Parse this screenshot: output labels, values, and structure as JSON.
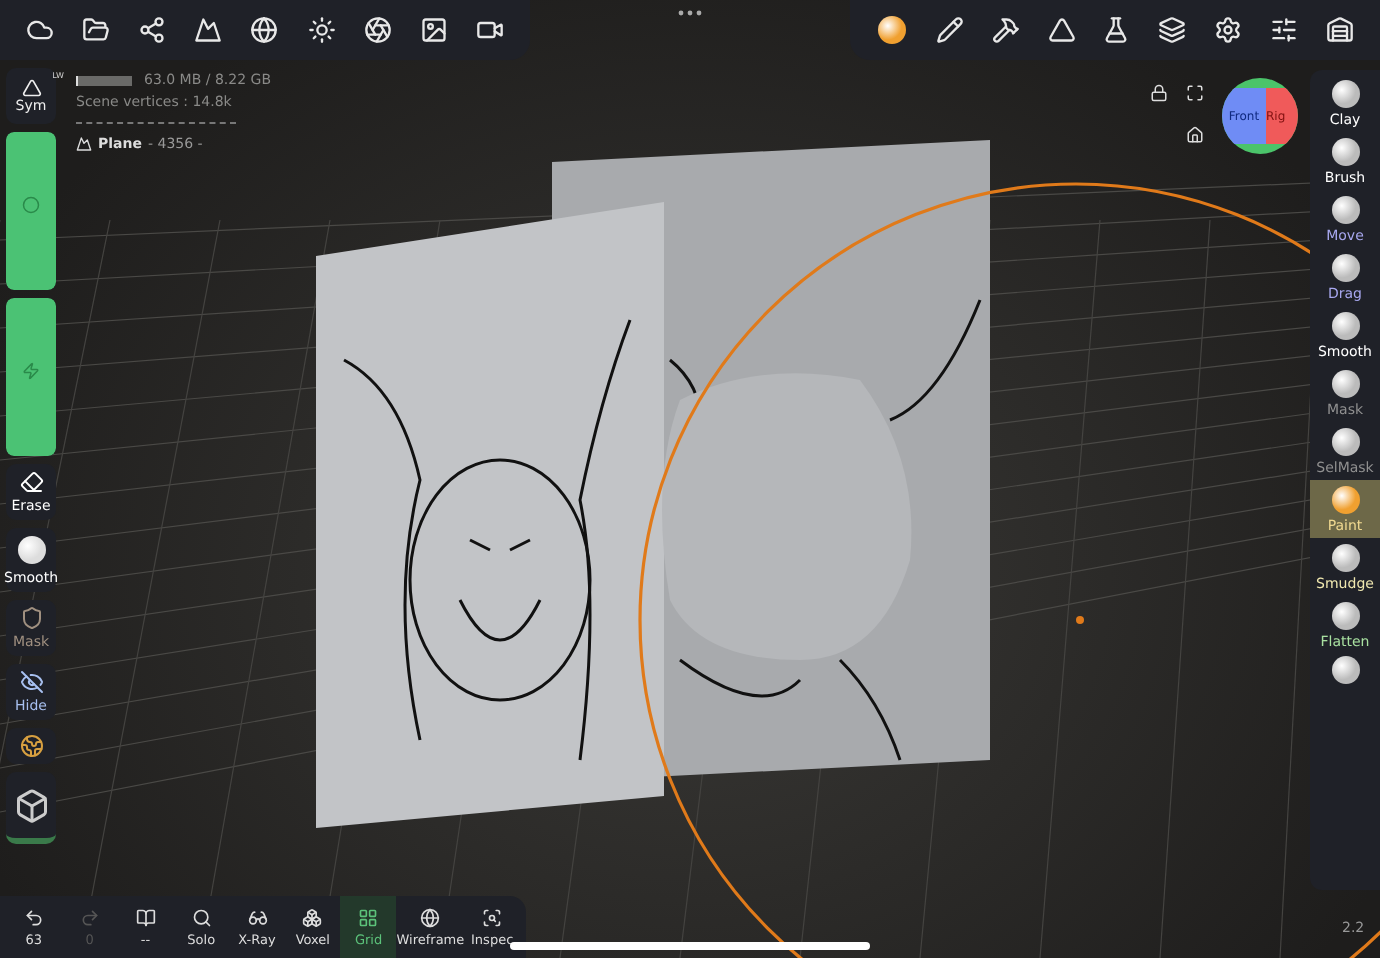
{
  "stats": {
    "memory": "63.0 MB / 8.22 GB",
    "memory_bar": {
      "level": 0.05
    },
    "vertices": "Scene vertices : 14.8k",
    "object": "Plane",
    "object_count": "- 4356 -"
  },
  "symmetry": {
    "label": "Sym",
    "badge": "LW"
  },
  "left_tools": [
    {
      "kind": "slider",
      "level": 1
    },
    {
      "kind": "slider",
      "level": 1
    },
    {
      "kind": "tool",
      "label": "Erase",
      "color": "#ffffff"
    },
    {
      "kind": "tool",
      "label": "Smooth",
      "color": "#ffffff"
    },
    {
      "kind": "tool",
      "label": "Mask",
      "color": "#a09080"
    },
    {
      "kind": "tool",
      "label": "Hide",
      "color": "#a8c0f0"
    },
    {
      "kind": "icon"
    }
  ],
  "gizmo": {
    "front": "Front",
    "right": "Rig"
  },
  "right_tools": [
    {
      "label": "Clay",
      "color": "#ffffff",
      "selected": false
    },
    {
      "label": "Brush",
      "color": "#ffffff",
      "selected": false
    },
    {
      "label": "Move",
      "color": "#a8a8f0",
      "selected": false
    },
    {
      "label": "Drag",
      "color": "#a8a8f0",
      "selected": false
    },
    {
      "label": "Smooth",
      "color": "#ffffff",
      "selected": false
    },
    {
      "label": "Mask",
      "color": "#909090",
      "selected": false
    },
    {
      "label": "SelMask",
      "color": "#909090",
      "selected": false
    },
    {
      "label": "Paint",
      "color": "#f0d890",
      "selected": true
    },
    {
      "label": "Smudge",
      "color": "#f0e8b0",
      "selected": false
    },
    {
      "label": "Flatten",
      "color": "#a8e0a0",
      "selected": false
    }
  ],
  "version": "2.2",
  "bottom_tools": [
    {
      "label": "63",
      "disabled": false,
      "selected": false
    },
    {
      "label": "0",
      "disabled": true,
      "selected": false
    },
    {
      "label": "--",
      "disabled": false,
      "selected": false
    },
    {
      "label": "Solo",
      "disabled": false,
      "selected": false
    },
    {
      "label": "X-Ray",
      "disabled": false,
      "selected": false
    },
    {
      "label": "Voxel",
      "disabled": false,
      "selected": false
    },
    {
      "label": "Grid",
      "disabled": false,
      "selected": true
    },
    {
      "label": "Wireframe",
      "disabled": false,
      "selected": false
    },
    {
      "label": "Inspec",
      "disabled": false,
      "selected": false
    }
  ]
}
